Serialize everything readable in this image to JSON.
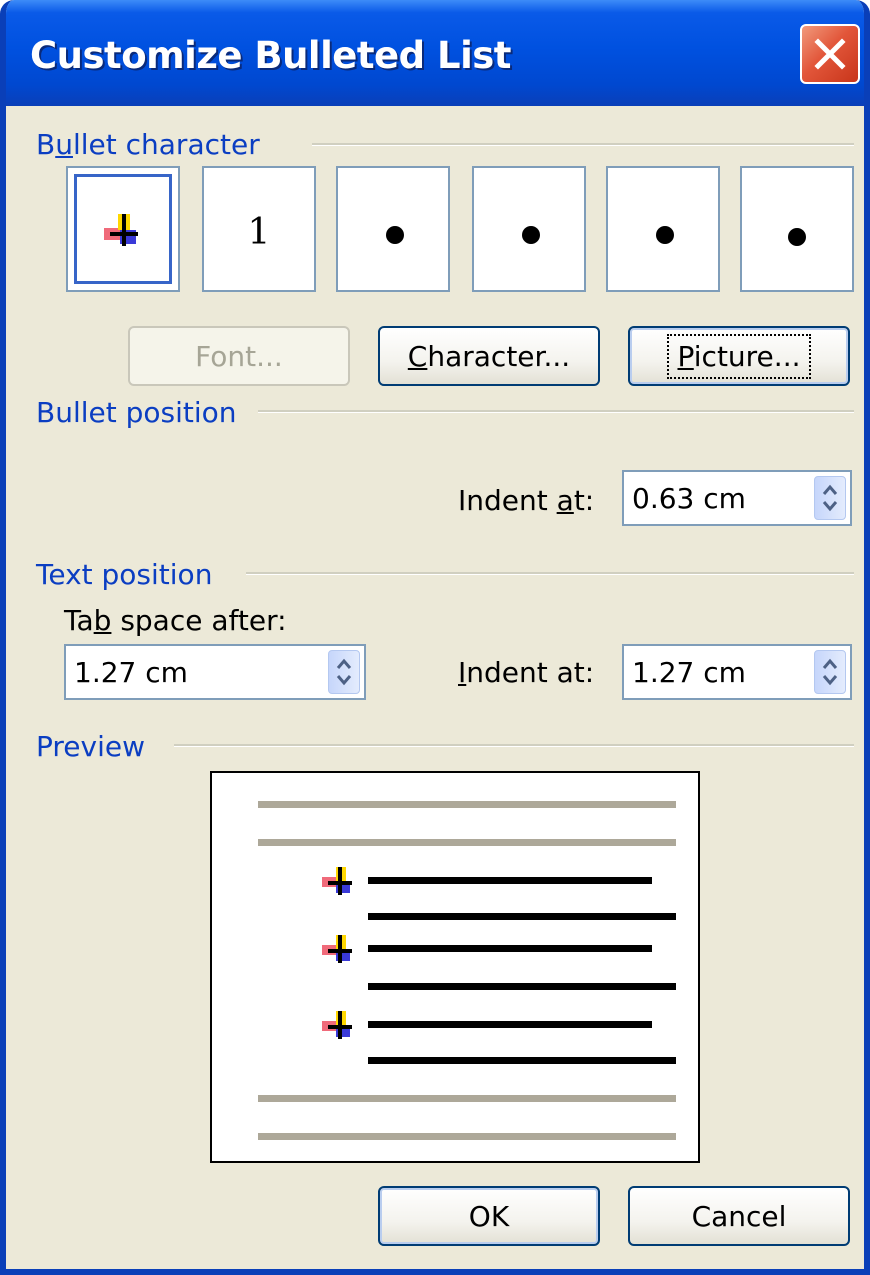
{
  "window": {
    "title": "Customize Bulleted List",
    "close_icon": "close-icon"
  },
  "bullet_character": {
    "label_pre": "B",
    "label_u": "u",
    "label_post": "llet character",
    "options": [
      {
        "kind": "picture",
        "icon": "picture-bullet-icon",
        "selected": true
      },
      {
        "kind": "text",
        "glyph": "1"
      },
      {
        "kind": "dot",
        "icon": "bullet-dot-icon"
      },
      {
        "kind": "dot",
        "icon": "bullet-dot-icon"
      },
      {
        "kind": "dot",
        "icon": "bullet-dot-icon"
      },
      {
        "kind": "dot",
        "icon": "bullet-dot-icon"
      }
    ],
    "font_button": "Font...",
    "character_button_u": "C",
    "character_button_rest": "haracter...",
    "picture_button_u": "P",
    "picture_button_rest": "icture..."
  },
  "bullet_position": {
    "label": "Bullet position",
    "indent_label_pre": "Indent ",
    "indent_label_u": "a",
    "indent_label_post": "t:",
    "indent_value": "0.63 cm"
  },
  "text_position": {
    "label": "Text position",
    "tab_label_pre": "Ta",
    "tab_label_u": "b",
    "tab_label_post": " space after:",
    "tab_value": "1.27 cm",
    "indent_label_u": "I",
    "indent_label_rest": "ndent at:",
    "indent_value": "1.27 cm"
  },
  "preview": {
    "label": "Preview"
  },
  "buttons": {
    "ok": "OK",
    "cancel": "Cancel"
  },
  "colors": {
    "titlebar": "#0051e0",
    "group_label": "#0b3ec2",
    "dialog_bg": "#ece9d8",
    "close_red": "#e2563a"
  }
}
